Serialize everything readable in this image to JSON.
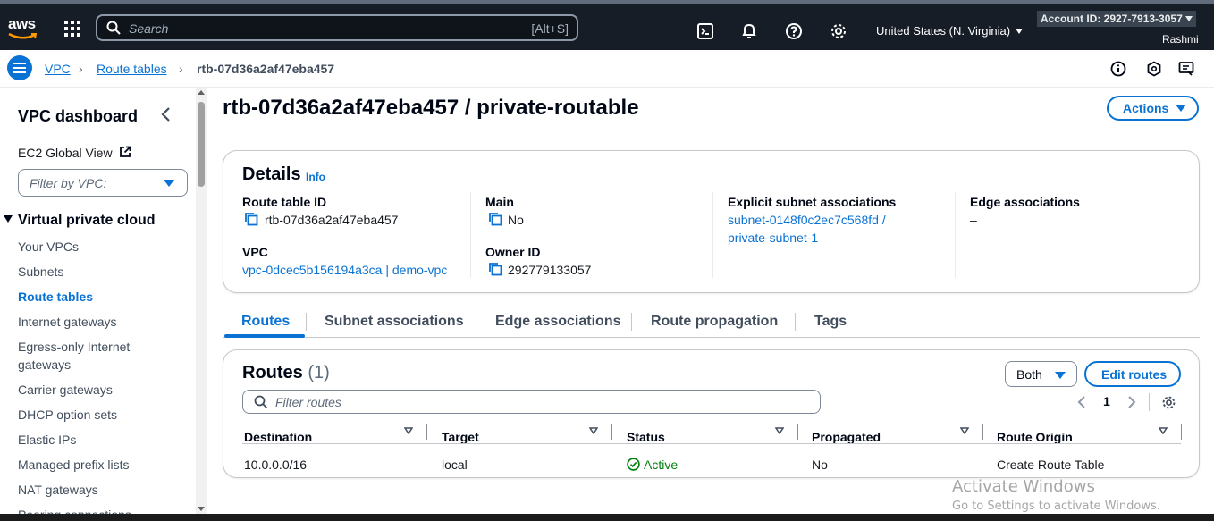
{
  "topnav": {
    "logo": "aws",
    "search_placeholder": "Search",
    "search_shortcut": "[Alt+S]",
    "region": "United States (N. Virginia)",
    "account": "Account ID: 2927-7913-3057",
    "user": "Rashmi"
  },
  "breadcrumb": {
    "items": [
      "VPC",
      "Route tables"
    ],
    "current": "rtb-07d36a2af47eba457"
  },
  "sidebar": {
    "title": "VPC dashboard",
    "ec2_link": "EC2 Global View",
    "filter_placeholder": "Filter by VPC:",
    "section": "Virtual private cloud",
    "items": [
      {
        "label": "Your VPCs"
      },
      {
        "label": "Subnets"
      },
      {
        "label": "Route tables"
      },
      {
        "label": "Internet gateways"
      },
      {
        "label": "Egress-only Internet gateways"
      },
      {
        "label": "Carrier gateways"
      },
      {
        "label": "DHCP option sets"
      },
      {
        "label": "Elastic IPs"
      },
      {
        "label": "Managed prefix lists"
      },
      {
        "label": "NAT gateways"
      },
      {
        "label": "Peering connections"
      }
    ]
  },
  "page": {
    "title": "rtb-07d36a2af47eba457 / private-routable",
    "actions_label": "Actions"
  },
  "details": {
    "heading": "Details",
    "info": "Info",
    "route_table_id_label": "Route table ID",
    "route_table_id": "rtb-07d36a2af47eba457",
    "vpc_label": "VPC",
    "vpc": "vpc-0dcec5b156194a3ca | demo-vpc",
    "main_label": "Main",
    "main": "No",
    "owner_label": "Owner ID",
    "owner": "292779133057",
    "explicit_label": "Explicit subnet associations",
    "explicit": "subnet-0148f0c2ec7c568fd / private-subnet-1",
    "edge_label": "Edge associations",
    "edge": "–"
  },
  "tabs": [
    "Routes",
    "Subnet associations",
    "Edge associations",
    "Route propagation",
    "Tags"
  ],
  "routes": {
    "heading": "Routes",
    "count": "(1)",
    "filter_select": "Both",
    "edit_label": "Edit routes",
    "filter_placeholder": "Filter routes",
    "page": "1",
    "columns": [
      "Destination",
      "Target",
      "Status",
      "Propagated",
      "Route Origin"
    ],
    "rows": [
      {
        "destination": "10.0.0.0/16",
        "target": "local",
        "status": "Active",
        "propagated": "No",
        "origin": "Create Route Table"
      }
    ]
  },
  "watermark": {
    "line1": "Activate Windows",
    "line2": "Go to Settings to activate Windows."
  },
  "colors": {
    "nav_bg": "#161d26",
    "link": "#0972d3",
    "success": "#037f0c"
  }
}
